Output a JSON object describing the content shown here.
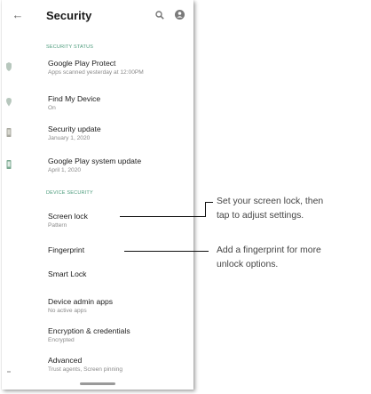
{
  "appbar": {
    "title": "Security",
    "back_icon": "back-arrow-icon",
    "search_icon": "search-icon",
    "account_icon": "account-icon"
  },
  "sections": {
    "status_header": "SECURITY STATUS",
    "device_header": "DEVICE SECURITY"
  },
  "items": {
    "play_protect": {
      "title": "Google Play Protect",
      "subtitle": "Apps scanned yesterday at 12:00PM"
    },
    "find_device": {
      "title": "Find My Device",
      "subtitle": "On"
    },
    "security_update": {
      "title": "Security update",
      "subtitle": "January 1, 2020"
    },
    "play_system_update": {
      "title": "Google Play system update",
      "subtitle": "April 1, 2020"
    },
    "screen_lock": {
      "title": "Screen lock",
      "subtitle": "Pattern"
    },
    "fingerprint": {
      "title": "Fingerprint"
    },
    "smart_lock": {
      "title": "Smart Lock"
    },
    "device_admin": {
      "title": "Device admin apps",
      "subtitle": "No active apps"
    },
    "encryption": {
      "title": "Encryption & credentials",
      "subtitle": "Encrypted"
    },
    "advanced": {
      "title": "Advanced",
      "subtitle": "Trust agents, Screen pinning"
    }
  },
  "callouts": {
    "screen_lock_line1": "Set your screen lock, then",
    "screen_lock_line2": "tap to adjust settings.",
    "fingerprint_line1": "Add a fingerprint for more",
    "fingerprint_line2": "unlock options."
  },
  "colors": {
    "section_header": "#4a9a7a",
    "status_icon": "#7aa890"
  }
}
